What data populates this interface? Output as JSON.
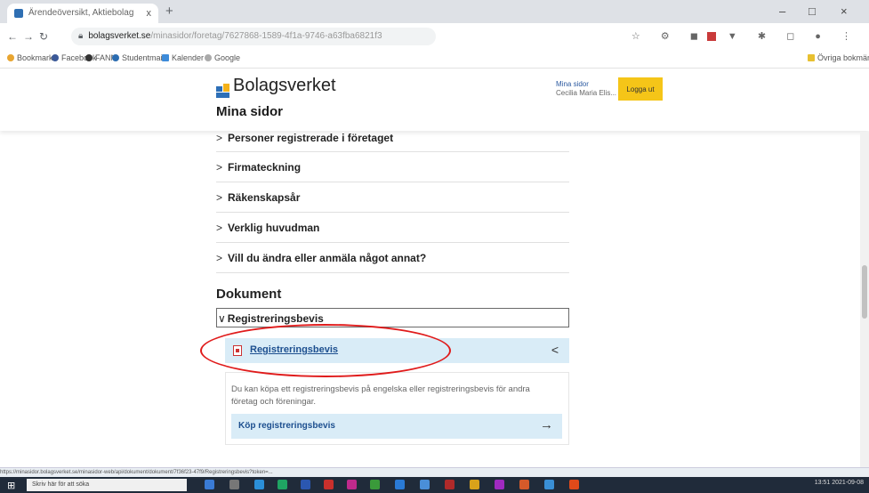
{
  "browser": {
    "tab_title": "Ärendeöversikt, Aktiebolag – Mi...",
    "tab_close": "x",
    "new_tab": "+",
    "window_controls": [
      "–",
      "□",
      "×"
    ],
    "url_domain": "bolagsverket.se",
    "url_rest": "/minasidor/foretag/7627868-1589-4f1a-9746-a63fba6821f3",
    "bookmarks": [
      "Bookmarks",
      "Facebook",
      "FANN",
      "Studentmail",
      "Kalender",
      "Google"
    ],
    "bookmarks_right": "Övriga bokmärken"
  },
  "header": {
    "logo_text": "Bolagsverket",
    "section_title": "Mina sidor",
    "user_link": "Mina sidor",
    "user_name": "Cecilia Maria Elis...",
    "login_button": "Logga ut"
  },
  "accordion": [
    {
      "label": "Personer registrerade i företaget"
    },
    {
      "label": "Firmateckning"
    },
    {
      "label": "Räkenskapsår"
    },
    {
      "label": "Verklig huvudman"
    },
    {
      "label": "Vill du ändra eller anmäla något annat?"
    }
  ],
  "documents": {
    "heading": "Dokument",
    "group_label": "Registreringsbevis",
    "link_label": "Registreringsbevis",
    "info_text": "Du kan köpa ett registreringsbevis på engelska eller registreringsbevis för andra företag och föreningar.",
    "buy_label": "Köp registreringsbevis"
  },
  "statusbar_text": "https://minasidor.bolagsverket.se/minasidor-web/api/dokument/dokument/7f36f23-47f9/Registreringsbevis?token=...",
  "taskbar": {
    "search_placeholder": "Skriv här för att söka",
    "time": "13:51",
    "date": "2021-09-08"
  },
  "colors": {
    "accent_yellow": "#f5c518",
    "link_blue": "#1d4f8f",
    "light_blue_bg": "#d9ecf7",
    "annotation_red": "#e01b1b"
  }
}
